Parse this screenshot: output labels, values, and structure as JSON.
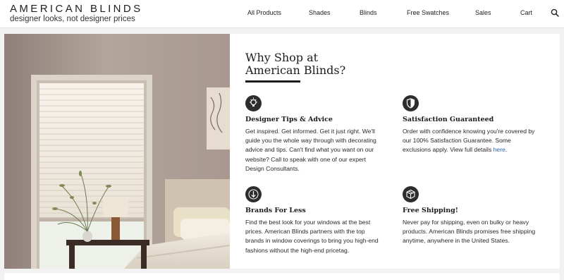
{
  "header": {
    "logo_name": "AMERICAN BLINDS",
    "logo_tagline": "designer looks, not designer prices",
    "nav": [
      "All Products",
      "Shades",
      "Blinds",
      "Free Swatches",
      "Sales",
      "Cart"
    ],
    "search_icon": "search-icon"
  },
  "hero": {
    "title_line1": "Why Shop at",
    "title_line2": "American Blinds?",
    "features": [
      {
        "icon": "lightbulb-icon",
        "title": "Designer Tips & Advice",
        "text": "Get inspired. Get informed. Get it just right. We'll guide you the whole way through with decorating advice and tips. Can't find what you want on our website? Call to speak with one of our expert Design Consultants."
      },
      {
        "icon": "shield-icon",
        "title": "Satisfaction Guaranteed",
        "text": "Order with confidence knowing you're covered by our 100% Satisfaction Guarantee. Some exclusions apply. View full details ",
        "link": "here",
        "text_after": "."
      },
      {
        "icon": "arrow-down-icon",
        "title": "Brands For Less",
        "text": "Find the best look for your windows at the best prices. American Blinds partners with the top brands in window coverings to bring you high-end fashions without the high-end pricetag."
      },
      {
        "icon": "package-icon",
        "title": "Free Shipping!",
        "text": "Never pay for shipping, even on bulky or heavy products. American Blinds promises free shipping anytime, anywhere in the United States."
      }
    ]
  },
  "colors": {
    "page_bg": "#f2f2f2",
    "text": "#222222",
    "link": "#2962b8",
    "icon_bg": "#2d2d2d"
  }
}
